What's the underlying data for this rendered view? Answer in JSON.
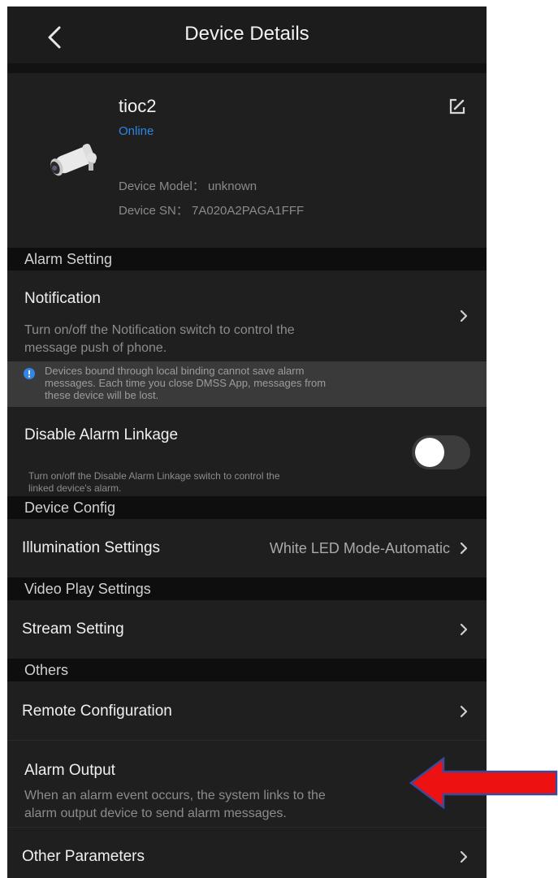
{
  "header": {
    "title": "Device Details"
  },
  "device": {
    "name": "tioc2",
    "status": "Online",
    "model": "Device Model： unknown",
    "sn": "Device SN： 7A020A2PAGA1FFF"
  },
  "alarm_setting": {
    "header": "Alarm Setting",
    "notification": {
      "title": "Notification",
      "desc_line1": "Turn on/off the Notification switch to control the",
      "desc_line2": "message push of phone."
    },
    "info": {
      "line1": "Devices bound through local binding cannot save alarm",
      "line2": "messages. Each time you close DMSS App, messages from",
      "line3": "these device will be lost."
    },
    "disable_linkage": {
      "title": "Disable Alarm Linkage",
      "desc_line1": "Turn on/off the Disable Alarm Linkage switch to control the",
      "desc_line2": "linked device's alarm.",
      "enabled": false
    }
  },
  "device_config": {
    "header": "Device Config",
    "illumination": {
      "title": "Illumination Settings",
      "value": "White LED Mode-Automatic"
    }
  },
  "video_play": {
    "header": "Video Play Settings",
    "stream": {
      "title": "Stream Setting"
    }
  },
  "others": {
    "header": "Others",
    "remote_config": {
      "title": "Remote Configuration"
    },
    "alarm_output": {
      "title": "Alarm Output",
      "desc_line1": "When an alarm event occurs, the system links to the",
      "desc_line2": "alarm output device to send alarm messages."
    },
    "other_params": {
      "title": "Other Parameters"
    }
  },
  "colors": {
    "background": "#1f1f1f",
    "section_header": "#0e0e0e",
    "accent_online": "#2f86e6",
    "annotation_arrow": "#ee1111"
  },
  "icons": {
    "back": "chevron-left-icon",
    "edit": "edit-icon",
    "chevron": "chevron-right-icon",
    "info": "info-icon",
    "camera": "bullet-camera-icon"
  }
}
